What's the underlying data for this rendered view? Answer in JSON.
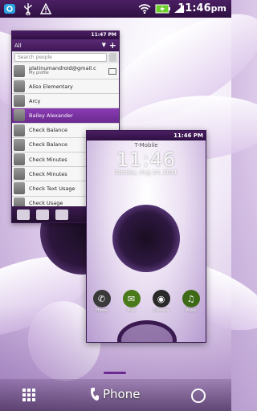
{
  "status_bar": {
    "time": "11:46",
    "time_suffix": "pm",
    "icons": [
      "htc-sense-icon",
      "usb-icon",
      "warning-icon",
      "wifi-icon",
      "battery-charging-icon",
      "signal-icon"
    ]
  },
  "recent_apps": {
    "people": {
      "status_time": "11:47",
      "status_suffix": "PM",
      "filter_label": "All",
      "search_placeholder": "Search people",
      "profile_name": "platinumandroid@gmail.c",
      "profile_sub": "My profile",
      "contacts": [
        "Aliso Elementary",
        "Arcy",
        "Bailey Alexander",
        "Check Balance",
        "Check Balance",
        "Check Minutes",
        "Check Minutes",
        "Check Text Usage",
        "Check Usage"
      ],
      "selected_index": 2
    },
    "lockscreen": {
      "status_time": "11:46",
      "status_suffix": "PM",
      "carrier": "T-Mobile",
      "clock": "11:46",
      "date": "Sunday, Aug 14, 2011",
      "dock_apps": [
        {
          "label": "Phone",
          "icon": "phone-icon",
          "color": "#3a3a3a"
        },
        {
          "label": "Mail",
          "icon": "mail-icon",
          "color": "#4a7a1a"
        },
        {
          "label": "Camera",
          "icon": "camera-icon",
          "color": "#2a2a2a"
        },
        {
          "label": "Music",
          "icon": "music-icon",
          "color": "#3e6a18"
        }
      ]
    }
  },
  "dock": {
    "phone_label": "Phone",
    "icons": [
      "all-apps-icon",
      "phone-icon",
      "personalize-icon"
    ]
  },
  "colors": {
    "accent": "#6a2a8f",
    "status_bar": "#3a1550"
  }
}
